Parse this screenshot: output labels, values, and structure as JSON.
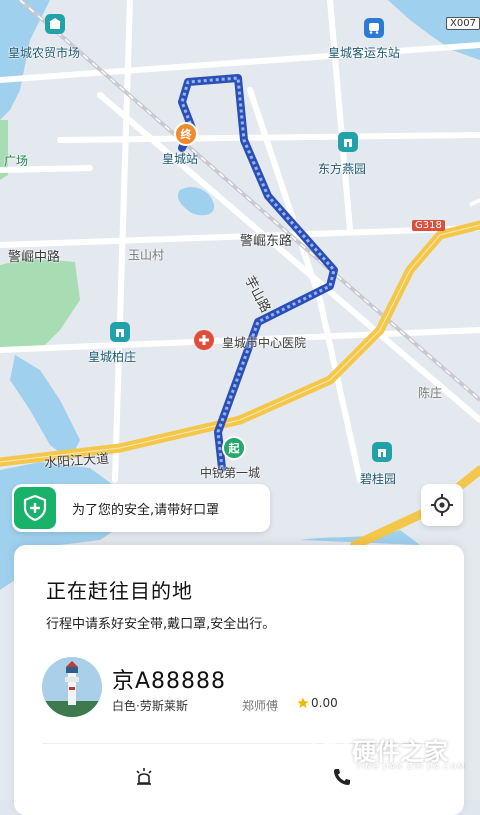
{
  "map": {
    "labels": {
      "market": "皇城农贸市场",
      "bus_station": "皇城客运东站",
      "road_code": "X007",
      "station": "皇城站",
      "square": "广场",
      "garden_east": "东方燕园",
      "road_jingwei_zhong": "警崛中路",
      "road_jingwei_dong": "警崛东路",
      "yushan_village": "玉山村",
      "yushan_road": "芋山路",
      "hospital": "皇城市中心医院",
      "baizhuang": "皇城柏庄",
      "chenzhuang": "陈庄",
      "river_avenue": "水阳江大道",
      "start_complex": "中锐第一城",
      "bigui_garden": "碧桂园",
      "highway_tag": "G318"
    },
    "markers": {
      "end_char": "终",
      "start_char": "起"
    }
  },
  "safety_tip": {
    "icon": "shield-plus-icon",
    "text": "为了您的安全,请带好口罩"
  },
  "locate_button": {
    "icon": "crosshair-icon"
  },
  "trip": {
    "status": "正在赶往目的地",
    "subtitle": "行程中请系好安全带,戴口罩,安全出行。",
    "plate": "京A88888",
    "car_model": "白色·劳斯莱斯",
    "driver": "郑师傅",
    "rating": "0.00"
  },
  "watermark": {
    "text": "硬件之家",
    "sub": "YING JIAN ZHI JIA.COM"
  }
}
